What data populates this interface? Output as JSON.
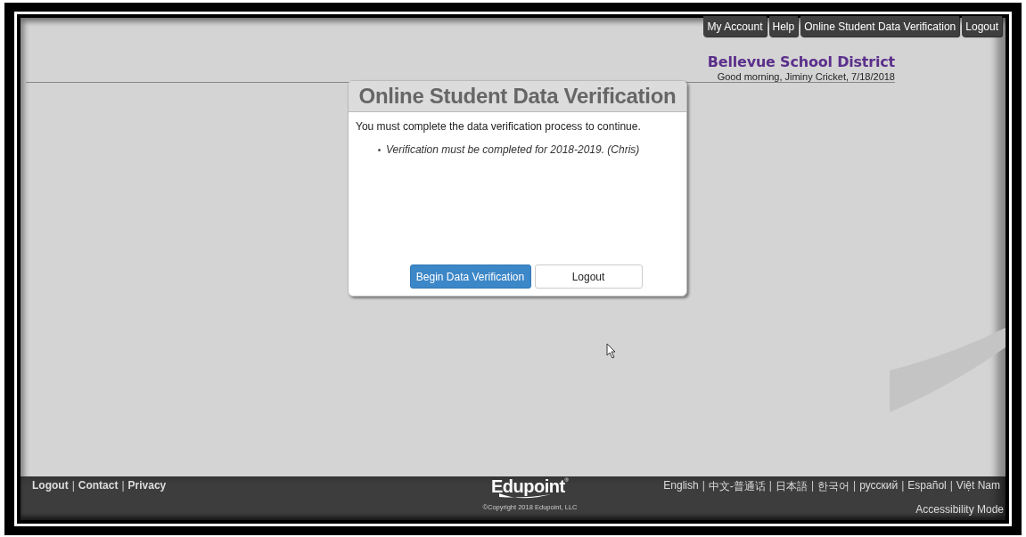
{
  "top_nav": [
    {
      "label": "My Account"
    },
    {
      "label": "Help"
    },
    {
      "label": "Online Student Data Verification"
    },
    {
      "label": "Logout"
    }
  ],
  "header": {
    "district": "Bellevue School District",
    "greeting": "Good morning, Jiminy Cricket, 7/18/2018"
  },
  "dialog": {
    "title": "Online Student Data Verification",
    "message": "You must complete the data verification process to continue.",
    "bullets": [
      "Verification must be completed for 2018-2019. (Chris)"
    ],
    "buttons": [
      {
        "label": "Begin Data Verification",
        "kind": "primary"
      },
      {
        "label": "Logout",
        "kind": "secondary"
      }
    ]
  },
  "footer": {
    "separator": "|",
    "links": [
      "Logout",
      "Contact",
      "Privacy"
    ],
    "logo": "Edupoint",
    "logo_mark": "®",
    "copyright": "©Copyright 2018 Edupoint, LLC",
    "languages": [
      "English",
      "中文-普通话",
      "日本語",
      "한국어",
      "русский",
      "Español",
      "Việt Nam"
    ],
    "accessibility": "Accessibility Mode"
  }
}
